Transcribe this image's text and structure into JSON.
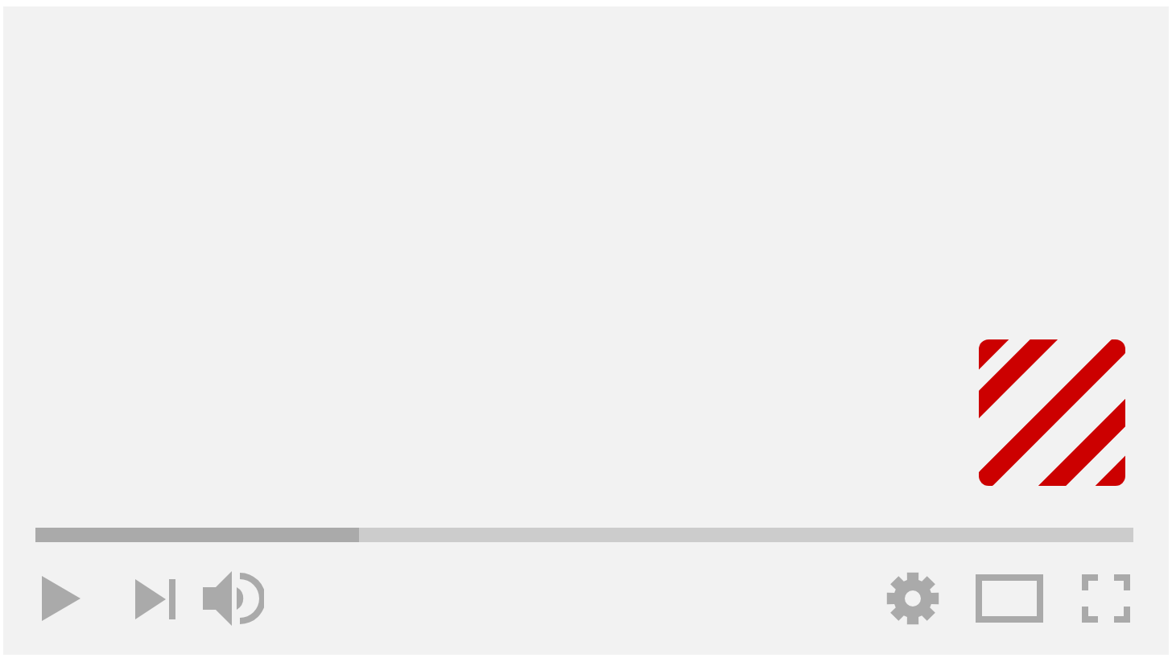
{
  "progress": {
    "level": 0.294
  }
}
